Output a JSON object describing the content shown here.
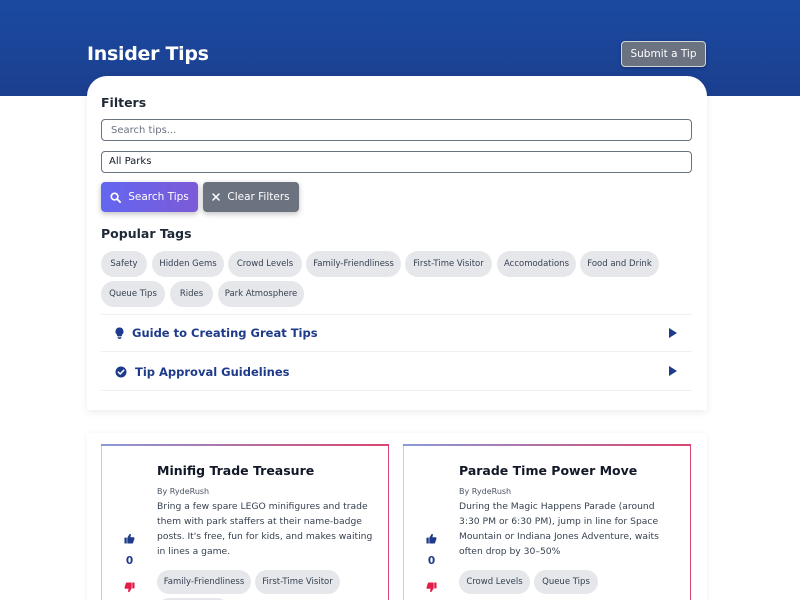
{
  "header": {
    "title": "Insider Tips",
    "submit_label": "Submit a Tip"
  },
  "filters": {
    "label": "Filters",
    "search_placeholder": "Search tips...",
    "park_selected": "All Parks",
    "search_button": "Search Tips",
    "clear_button": "Clear Filters"
  },
  "popular_tags": {
    "label": "Popular Tags",
    "tags": [
      "Safety",
      "Hidden Gems",
      "Crowd Levels",
      "Family-Friendliness",
      "First-Time Visitor",
      "Accomodations",
      "Food and Drink",
      "Queue Tips",
      "Rides",
      "Park Atmosphere"
    ]
  },
  "guides": [
    {
      "title": "Guide to Creating Great Tips",
      "icon": "lightbulb-icon"
    },
    {
      "title": "Tip Approval Guidelines",
      "icon": "check-circle-icon"
    }
  ],
  "tips": [
    {
      "title": "Minifig Trade Treasure",
      "author": "By RydeRush",
      "body": "Bring a few spare LEGO minifigures and trade them with park staffers at their name-badge posts. It's free, fun for kids, and makes waiting in lines a game.",
      "votes": "0",
      "tags": [
        "Family-Friendliness",
        "First-Time Visitor"
      ]
    },
    {
      "title": "Parade Time Power Move",
      "author": "By RydeRush",
      "body": "During the Magic Happens Parade (around 3:30 PM or 6:30 PM), jump in line for Space Mountain or Indiana Jones Adventure, waits often drop by 30–50%",
      "votes": "0",
      "tags": [
        "Crowd Levels",
        "Queue Tips"
      ]
    }
  ],
  "colors": {
    "header_bg": "#1a4aa0",
    "accent_purple": "#6366f1",
    "heading_blue": "#1e3a8a",
    "downvote_pink": "#e11d48",
    "tag_bg": "#e5e7eb"
  }
}
